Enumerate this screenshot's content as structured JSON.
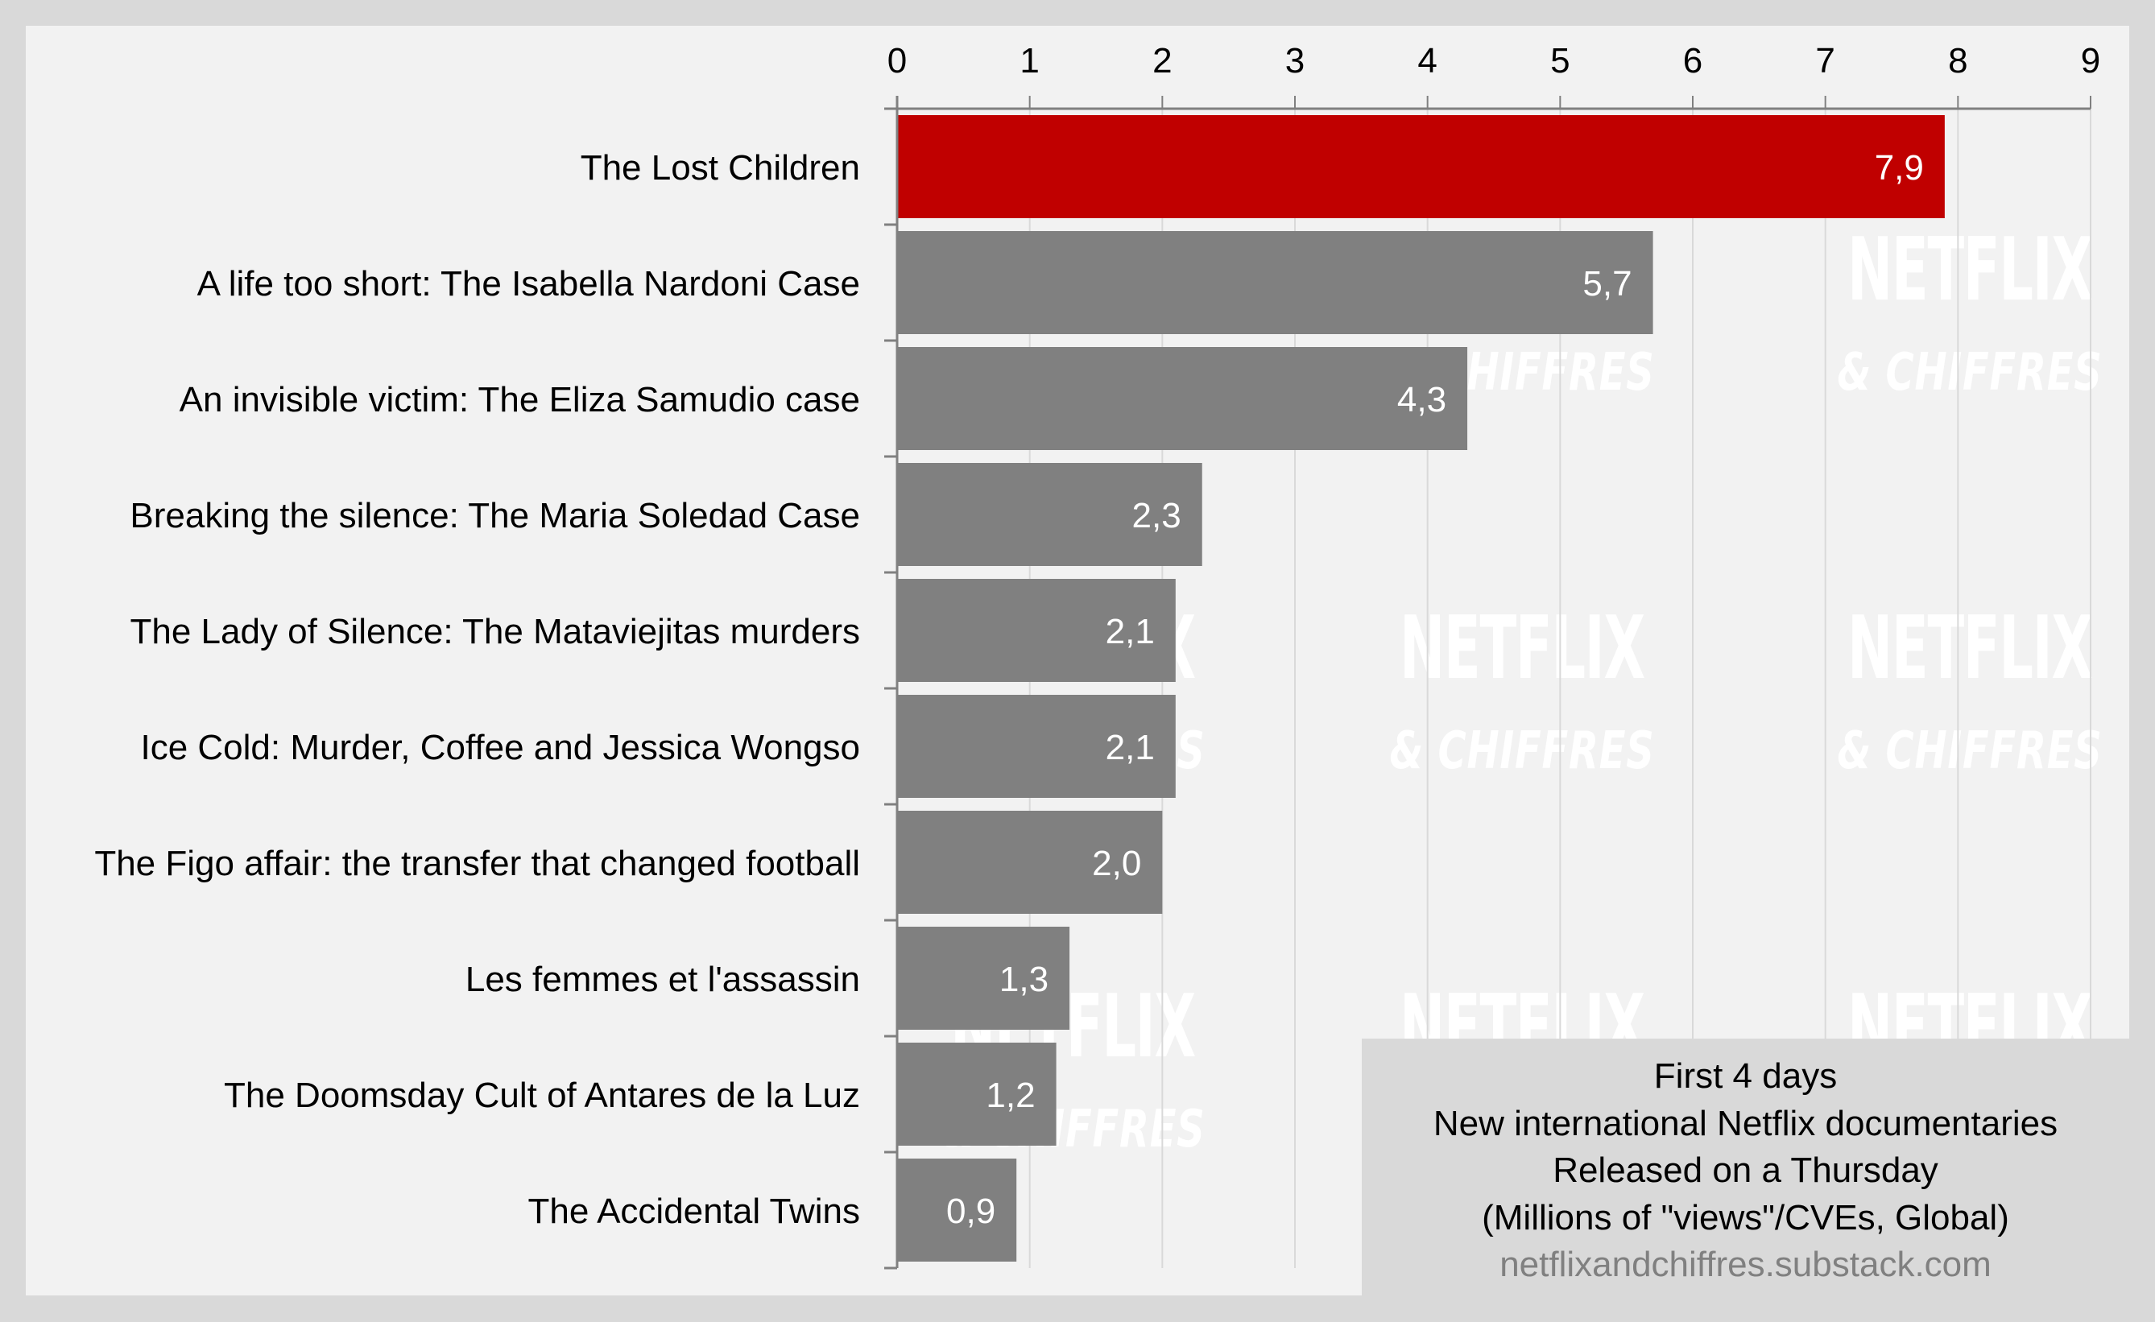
{
  "colors": {
    "highlight": "#c00000",
    "bar": "#808080",
    "panel_bg": "#f2f2f2",
    "outer_bg": "#d9d9d9",
    "gridline": "#d9d9d9",
    "axis": "#808080",
    "watermark": "#ffffff"
  },
  "watermark": {
    "line1": "NETFLIX",
    "line2": "& CHIFFRES"
  },
  "legend": {
    "lines": [
      "First 4 days",
      "New international Netflix documentaries",
      "Released on a Thursday",
      "(Millions of \"views\"/CVEs, Global)"
    ],
    "source": "netflixandchiffres.substack.com"
  },
  "chart_data": {
    "type": "bar",
    "orientation": "horizontal",
    "title": "First 4 days - New international Netflix documentaries - Released on a Thursday",
    "xlabel": "Millions of \"views\"/CVEs, Global",
    "ylabel": "",
    "xlim": [
      0,
      9
    ],
    "x_ticks": [
      "0",
      "1",
      "2",
      "3",
      "4",
      "5",
      "6",
      "7",
      "8",
      "9"
    ],
    "x_axis_position": "top",
    "grid": true,
    "legend_position": "bottom-right",
    "decimal_separator": ",",
    "categories": [
      "The Lost Children",
      "A life too short: The Isabella Nardoni Case",
      "An invisible victim: The Eliza Samudio case",
      "Breaking the silence: The Maria Soledad Case",
      "The Lady of Silence: The Mataviejitas murders",
      "Ice Cold: Murder, Coffee and Jessica Wongso",
      "The Figo affair: the transfer that changed football",
      "Les femmes et l'assassin",
      "The Doomsday Cult of Antares de la Luz",
      "The Accidental Twins"
    ],
    "values": [
      7.9,
      5.7,
      4.3,
      2.3,
      2.1,
      2.1,
      2.0,
      1.3,
      1.2,
      0.9
    ],
    "value_labels": [
      "7,9",
      "5,7",
      "4,3",
      "2,3",
      "2,1",
      "2,1",
      "2,0",
      "1,3",
      "1,2",
      "0,9"
    ],
    "highlighted": [
      true,
      false,
      false,
      false,
      false,
      false,
      false,
      false,
      false,
      false
    ]
  }
}
